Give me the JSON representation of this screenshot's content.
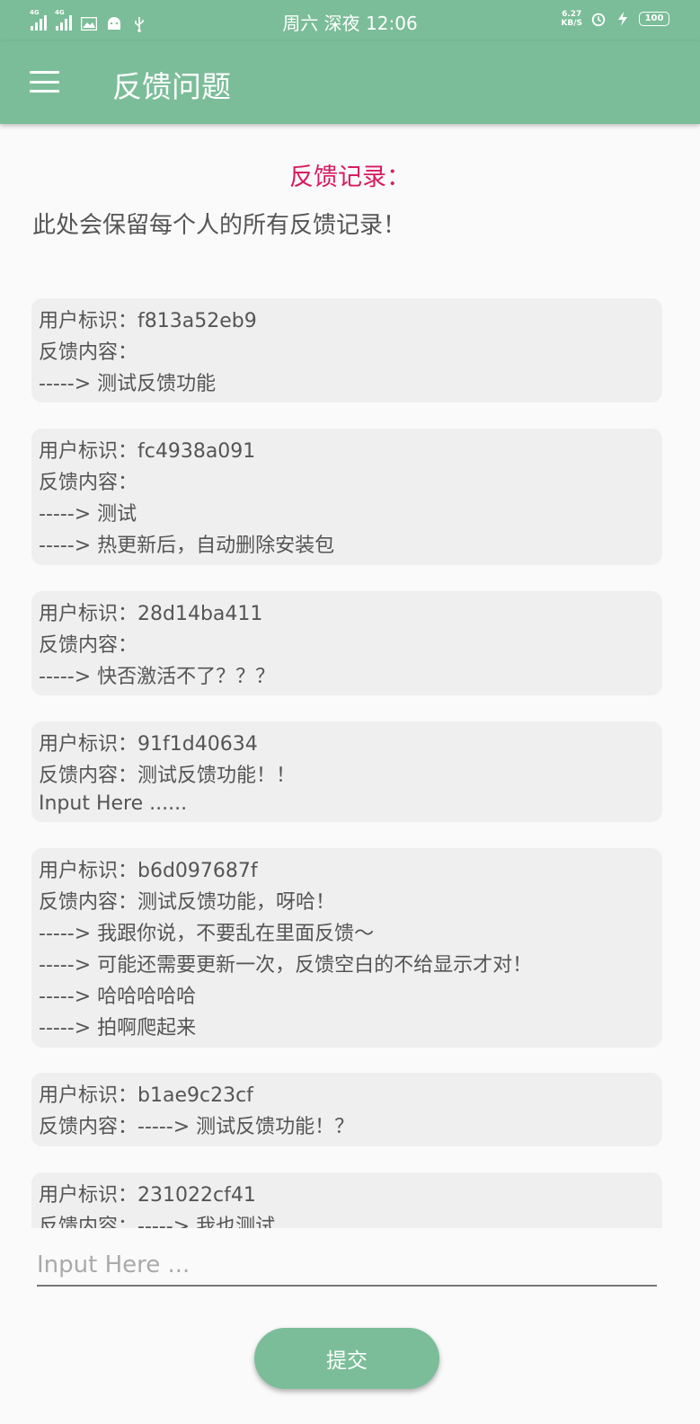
{
  "status_bar": {
    "network_1": "4G",
    "network_2": "4G",
    "time": "周六 深夜 12:06",
    "speed_value": "6.27",
    "speed_unit": "KB/S",
    "battery": "100"
  },
  "app_bar": {
    "title": "反馈问题"
  },
  "records": {
    "heading": "反馈记录：",
    "description": "此处会保留每个人的所有反馈记录！",
    "cards": [
      {
        "lines": [
          "用户标识：f813a52eb9",
          "反馈内容：",
          "-----> 测试反馈功能"
        ]
      },
      {
        "lines": [
          "用户标识：fc4938a091",
          "反馈内容：",
          "-----> 测试",
          "-----> 热更新后，自动删除安装包"
        ]
      },
      {
        "lines": [
          "用户标识：28d14ba411",
          "反馈内容：",
          "-----> 快否激活不了？？？"
        ]
      },
      {
        "lines": [
          "用户标识：91f1d40634",
          "反馈内容：测试反馈功能！！",
          "Input Here ......"
        ]
      },
      {
        "lines": [
          "用户标识：b6d097687f",
          "反馈内容：测试反馈功能，呀哈！",
          "-----> 我跟你说，不要乱在里面反馈～",
          "-----> 可能还需要更新一次，反馈空白的不给显示才对！",
          "-----> 哈哈哈哈哈",
          "-----> 拍啊爬起来"
        ]
      },
      {
        "lines": [
          "用户标识：b1ae9c23cf",
          "反馈内容：-----> 测试反馈功能！？"
        ]
      },
      {
        "lines": [
          "用户标识：231022cf41",
          "反馈内容：-----> 我也测试"
        ]
      }
    ]
  },
  "feedback_input": {
    "value": "",
    "placeholder": "Input Here ..."
  },
  "submit_label": "提交",
  "colors": {
    "primary": "#7bbd99",
    "accent": "#d81b60",
    "card_bg": "#efefef"
  }
}
